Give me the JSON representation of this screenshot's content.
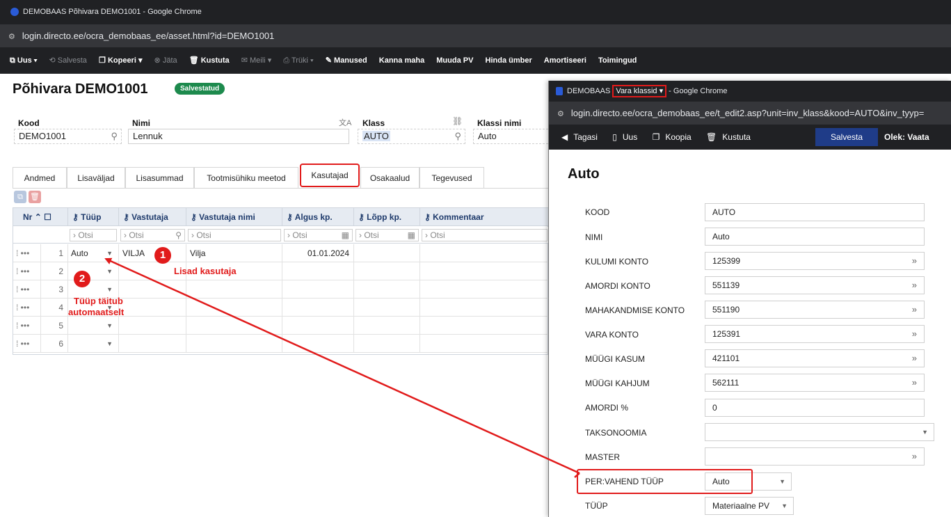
{
  "main_window": {
    "title": "DEMOBAAS Põhivara DEMO1001 - Google Chrome",
    "url": "login.directo.ee/ocra_demobaas_ee/asset.html?id=DEMO1001",
    "toolbar": {
      "uus": "Uus",
      "salvesta": "Salvesta",
      "kopeeri": "Kopeeri",
      "jata": "Jäta",
      "kustuta": "Kustuta",
      "meili": "Meili",
      "truki": "Trüki",
      "manused": "Manused",
      "kanna_maha": "Kanna maha",
      "muuda_pv": "Muuda PV",
      "hinda_umber": "Hinda ümber",
      "amortiseeri": "Amortiseeri",
      "toimingud": "Toimingud"
    },
    "page_title": "Põhivara DEMO1001",
    "status_badge": "Salvestatud",
    "fields": {
      "kood_label": "Kood",
      "kood_value": "DEMO1001",
      "nimi_label": "Nimi",
      "nimi_value": "Lennuk",
      "klass_label": "Klass",
      "klass_value": "AUTO",
      "klassi_nimi_label": "Klassi nimi",
      "klassi_nimi_value": "Auto"
    },
    "tabs": [
      "Andmed",
      "Lisaväljad",
      "Lisasummad",
      "Tootmisühiku meetod",
      "Kasutajad",
      "Osakaalud",
      "Tegevused"
    ],
    "grid": {
      "columns": [
        "Nr",
        "Tüüp",
        "Vastutaja",
        "Vastutaja nimi",
        "Algus kp.",
        "Lõpp kp.",
        "Kommentaar"
      ],
      "filter_placeholder": "Otsi",
      "rows": [
        {
          "nr": "1",
          "tyyp": "Auto",
          "vastutaja": "VILJA",
          "vastutaja_nimi": "Vilja",
          "algus": "01.01.2024",
          "lopp": "",
          "kommentaar": ""
        },
        {
          "nr": "2",
          "tyyp": "",
          "vastutaja": "",
          "vastutaja_nimi": "",
          "algus": "",
          "lopp": "",
          "kommentaar": ""
        },
        {
          "nr": "3",
          "tyyp": "",
          "vastutaja": "",
          "vastutaja_nimi": "",
          "algus": "",
          "lopp": "",
          "kommentaar": ""
        },
        {
          "nr": "4",
          "tyyp": "",
          "vastutaja": "",
          "vastutaja_nimi": "",
          "algus": "",
          "lopp": "",
          "kommentaar": ""
        },
        {
          "nr": "5",
          "tyyp": "",
          "vastutaja": "",
          "vastutaja_nimi": "",
          "algus": "",
          "lopp": "",
          "kommentaar": ""
        },
        {
          "nr": "6",
          "tyyp": "",
          "vastutaja": "",
          "vastutaja_nimi": "",
          "algus": "",
          "lopp": "",
          "kommentaar": ""
        }
      ]
    },
    "annotations": {
      "num1": "1",
      "text1": "Lisad kasutaja",
      "num2": "2",
      "text2_line1": "Tüüp täitub",
      "text2_line2": "automaatselt"
    }
  },
  "popup_window": {
    "title_prefix": "DEMOBAAS",
    "title_highlight": "Vara klassid",
    "title_suffix": "- Google Chrome",
    "url": "login.directo.ee/ocra_demobaas_ee/t_edit2.asp?unit=inv_klass&kood=AUTO&inv_tyyp=",
    "toolbar": {
      "tagasi": "Tagasi",
      "uus": "Uus",
      "koopia": "Koopia",
      "kustuta": "Kustuta",
      "salvesta": "Salvesta",
      "olek": "Olek: Vaata"
    },
    "heading": "Auto",
    "fields": [
      {
        "label": "KOOD",
        "value": "AUTO",
        "type": "text"
      },
      {
        "label": "NIMI",
        "value": "Auto",
        "type": "text"
      },
      {
        "label": "KULUMI KONTO",
        "value": "125399",
        "type": "lookup"
      },
      {
        "label": "AMORDI KONTO",
        "value": "551139",
        "type": "lookup"
      },
      {
        "label": "MAHAKANDMISE KONTO",
        "value": "551190",
        "type": "lookup"
      },
      {
        "label": "VARA KONTO",
        "value": "125391",
        "type": "lookup"
      },
      {
        "label": "MÜÜGI KASUM",
        "value": "421101",
        "type": "lookup"
      },
      {
        "label": "MÜÜGI KAHJUM",
        "value": "562111",
        "type": "lookup"
      },
      {
        "label": "AMORDI %",
        "value": "0",
        "type": "text"
      },
      {
        "label": "TAKSONOOMIA",
        "value": "",
        "type": "select"
      },
      {
        "label": "MASTER",
        "value": "",
        "type": "lookup"
      },
      {
        "label": "PER:VAHEND TÜÜP",
        "value": "Auto",
        "type": "select_small"
      },
      {
        "label": "TÜÜP",
        "value": "Materiaalne PV",
        "type": "select_small"
      }
    ]
  },
  "colors": {
    "accent_red": "#e11b1b",
    "saved_green": "#1d8a4d",
    "save_button_blue": "#1f3c88",
    "grid_header": "#e6ebf2"
  }
}
